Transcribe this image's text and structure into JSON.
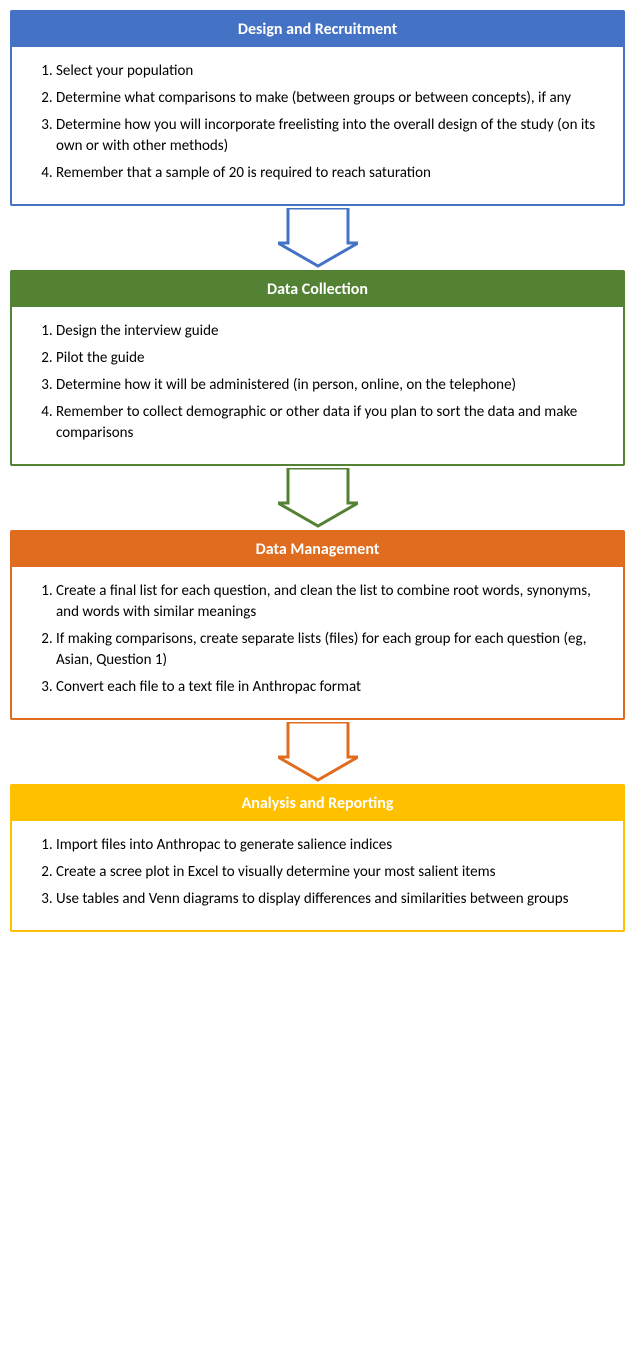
{
  "sections": {
    "design": {
      "title": "Design and Recruitment",
      "color": "#4472C4",
      "border_color": "#4472C4",
      "items": [
        "Select your population",
        "Determine what comparisons to make (between groups or between concepts), if any",
        "Determine how you will incorporate freelisting into the overall design of the study (on its own or with other methods)",
        "Remember that a sample of 20 is required to reach saturation"
      ]
    },
    "collection": {
      "title": "Data Collection",
      "color": "#548235",
      "border_color": "#548235",
      "items": [
        "Design the interview guide",
        "Pilot the guide",
        "Determine how it will be administered (in person, online, on the telephone)",
        "Remember to collect demographic or other data if you plan to sort the data and make comparisons"
      ]
    },
    "management": {
      "title": "Data Management",
      "color": "#E06C1F",
      "border_color": "#E06C1F",
      "items": [
        "Create a final list for each question, and clean the list to combine root words, synonyms, and words with similar meanings",
        "If making comparisons, create separate lists (files) for each group for each question (eg, Asian, Question 1)",
        "Convert each file to a text file in Anthropac format"
      ]
    },
    "analysis": {
      "title": "Analysis and Reporting",
      "color": "#FFC000",
      "border_color": "#FFC000",
      "items": [
        "Import files into Anthropac to generate salience indices",
        "Create a scree plot in Excel to visually determine your most salient items",
        "Use tables and Venn diagrams to display differences and similarities between groups"
      ]
    },
    "arrows": {
      "blue_color": "#4472C4",
      "green_color": "#548235",
      "orange_color": "#E06C1F"
    }
  }
}
